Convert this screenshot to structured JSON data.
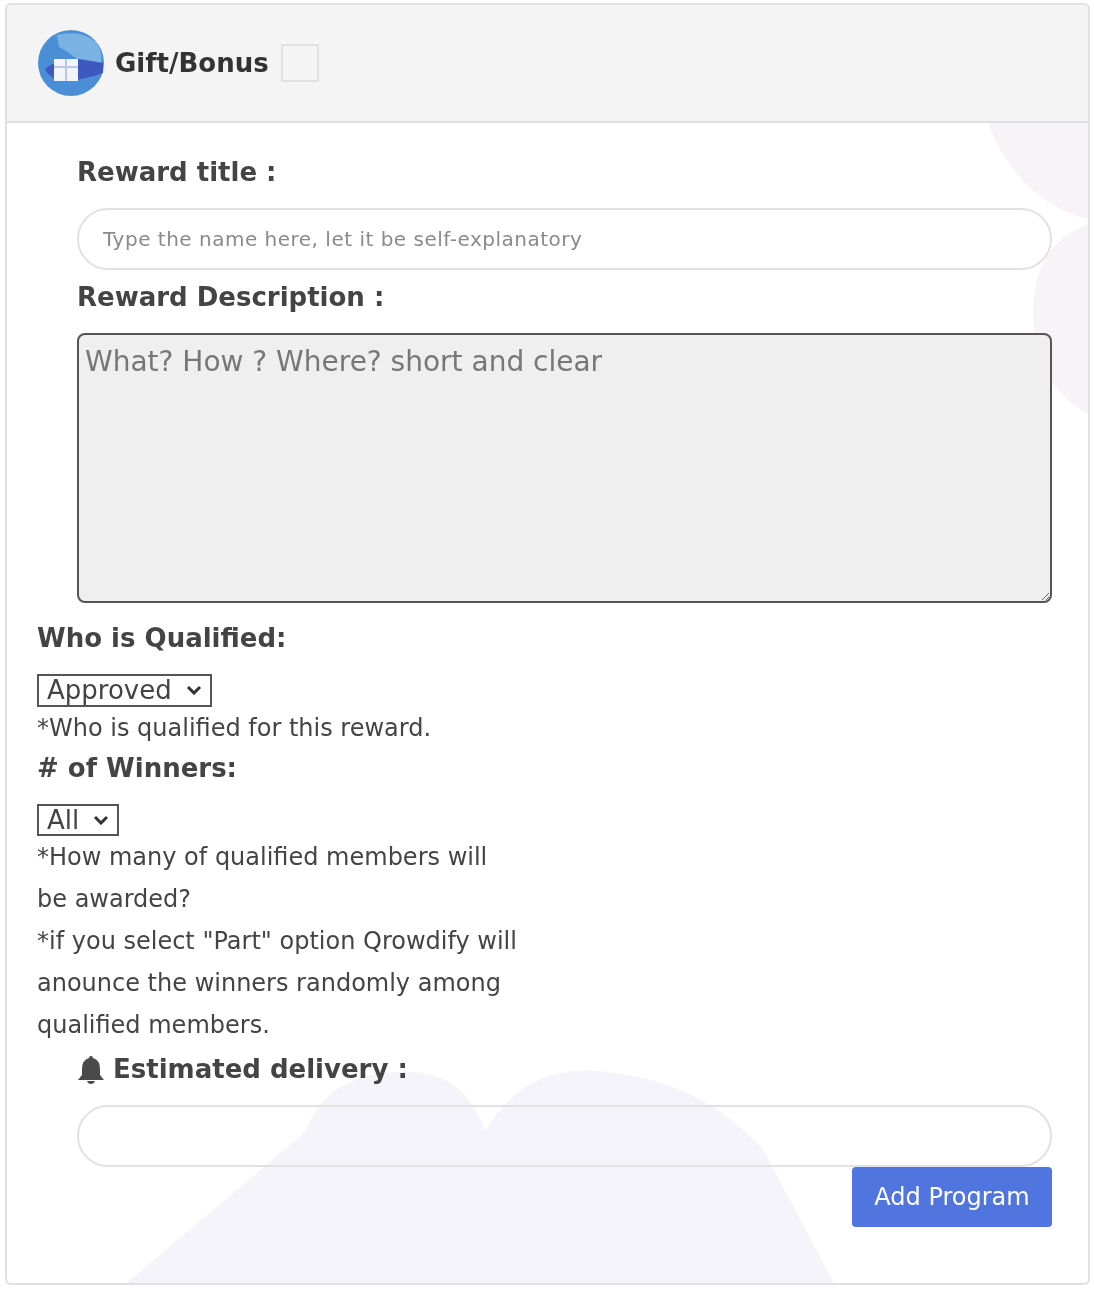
{
  "header": {
    "title": "Gift/Bonus",
    "checked": false
  },
  "reward_title": {
    "label": "Reward title :",
    "placeholder": "Type the name here, let it be self-explanatory"
  },
  "reward_description": {
    "label": "Reward Description :",
    "placeholder": "What? How ? Where? short and clear"
  },
  "qualified": {
    "label": "Who is Qualified:",
    "value": "Approved",
    "help": [
      "*Who is qualified for this reward."
    ]
  },
  "winners": {
    "label": "# of Winners:",
    "value": "All",
    "help": [
      "*How many of qualified members will be awarded?",
      "*if you select \"Part\" option Qrowdify will anounce the winners randomly among qualified members."
    ]
  },
  "estimated_delivery": {
    "label": "Estimated delivery :"
  },
  "submit": {
    "label": "Add Program"
  }
}
